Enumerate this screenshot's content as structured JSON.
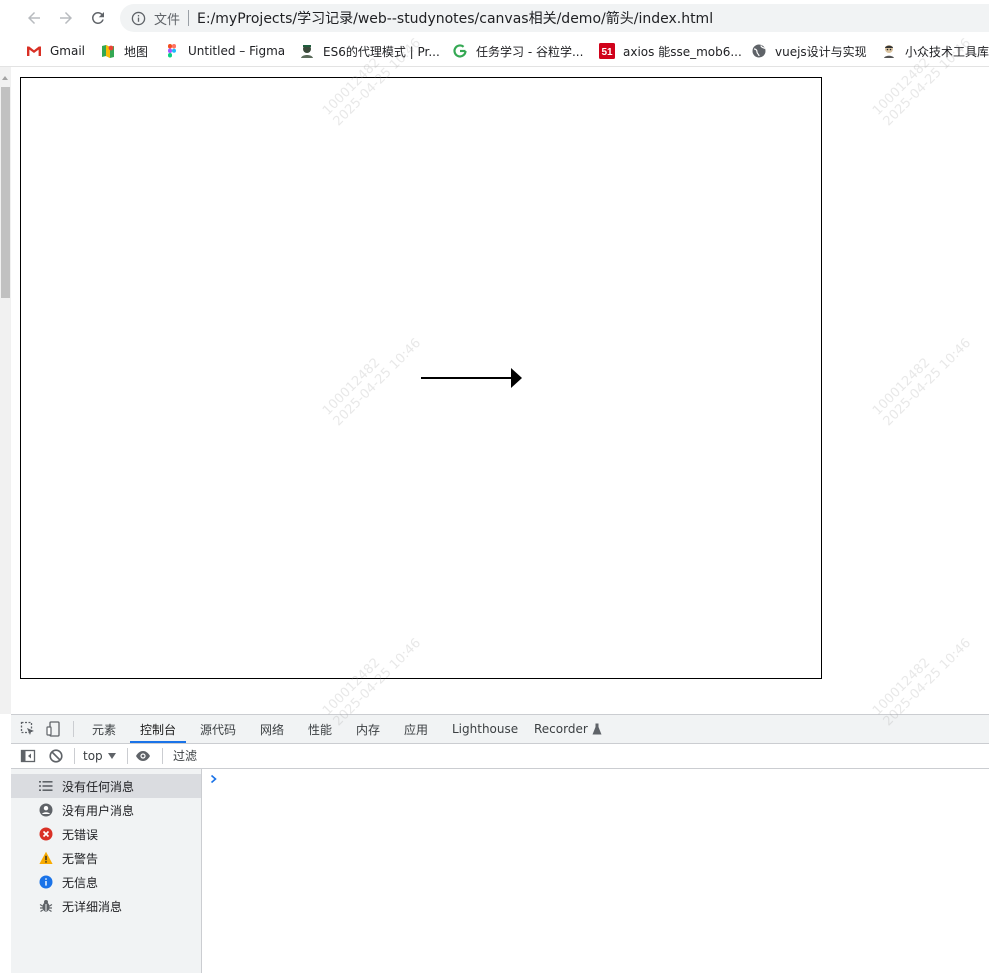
{
  "browser": {
    "scheme_label": "文件",
    "url": "E:/myProjects/学习记录/web--studynotes/canvas相关/demo/箭头/index.html"
  },
  "bookmarks": [
    {
      "label": "Gmail",
      "icon": "gmail-icon"
    },
    {
      "label": "地图",
      "icon": "maps-icon"
    },
    {
      "label": "Untitled – Figma",
      "icon": "figma-icon"
    },
    {
      "label": "ES6的代理模式 | Pr...",
      "icon": "avatar-icon"
    },
    {
      "label": "任务学习 - 谷粒学...",
      "icon": "g-logo-icon"
    },
    {
      "label": "axios 能sse_mob6...",
      "icon": "51cto-icon"
    },
    {
      "label": "vuejs设计与实现",
      "icon": "globe-icon"
    },
    {
      "label": "小众技术工具库",
      "icon": "avatar-icon"
    }
  ],
  "canvas": {
    "arrow_direction": "right",
    "stroke_color": "#000000"
  },
  "devtools": {
    "tabs": [
      "元素",
      "控制台",
      "源代码",
      "网络",
      "性能",
      "内存",
      "应用",
      "Lighthouse",
      "Recorder"
    ],
    "active_tab": "控制台",
    "context_selector": "top",
    "filter_placeholder": "过滤",
    "sidebar": [
      {
        "label": "没有任何消息",
        "icon": "list-icon"
      },
      {
        "label": "没有用户消息",
        "icon": "user-icon"
      },
      {
        "label": "无错误",
        "icon": "error-icon"
      },
      {
        "label": "无警告",
        "icon": "warning-icon"
      },
      {
        "label": "无信息",
        "icon": "info-icon"
      },
      {
        "label": "无详细消息",
        "icon": "bug-icon"
      }
    ],
    "selected_sidebar_index": 0
  },
  "watermark": {
    "line1": "100012482",
    "line2": "2025-04-25 10:46"
  },
  "colors": {
    "accent": "#1a73e8",
    "error": "#d93025",
    "warning": "#f9ab00",
    "info": "#1a73e8"
  }
}
